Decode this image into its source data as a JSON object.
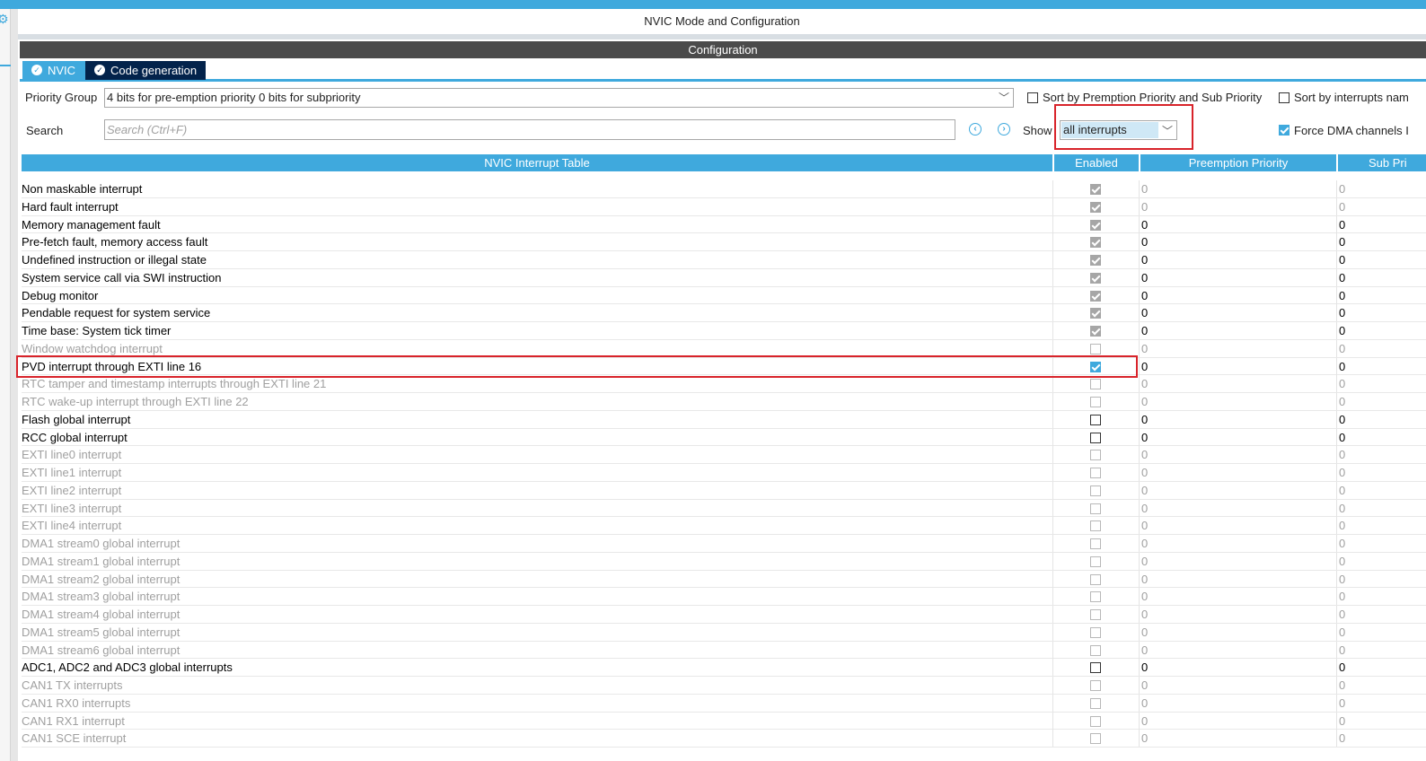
{
  "panel": {
    "title": "NVIC Mode and Configuration",
    "config_bar": "Configuration"
  },
  "tabs": [
    {
      "label": "NVIC"
    },
    {
      "label": "Code generation"
    }
  ],
  "controls": {
    "priority_group_label": "Priority Group",
    "priority_group_value": "4 bits for pre-emption priority 0 bits for subpriority",
    "sort_premption_label": "Sort by Premption Priority and Sub Priority",
    "sort_names_label": "Sort by interrupts nam",
    "search_label": "Search",
    "search_placeholder": "Search (Ctrl+F)",
    "show_label": "Show",
    "show_value": "all interrupts",
    "force_dma_label": "Force DMA channels I"
  },
  "table": {
    "headers": [
      "NVIC Interrupt Table",
      "Enabled",
      "Preemption Priority",
      "Sub Pri"
    ],
    "rows": [
      {
        "name": "Non maskable interrupt",
        "enabled": "on-disabled",
        "pp": "0",
        "sp": "0",
        "style": "grey-val"
      },
      {
        "name": "Hard fault interrupt",
        "enabled": "on-disabled",
        "pp": "0",
        "sp": "0",
        "style": "grey-val"
      },
      {
        "name": "Memory management fault",
        "enabled": "on-disabled",
        "pp": "0",
        "sp": "0",
        "style": ""
      },
      {
        "name": "Pre-fetch fault, memory access fault",
        "enabled": "on-disabled",
        "pp": "0",
        "sp": "0",
        "style": ""
      },
      {
        "name": "Undefined instruction or illegal state",
        "enabled": "on-disabled",
        "pp": "0",
        "sp": "0",
        "style": ""
      },
      {
        "name": "System service call via SWI instruction",
        "enabled": "on-disabled",
        "pp": "0",
        "sp": "0",
        "style": ""
      },
      {
        "name": "Debug monitor",
        "enabled": "on-disabled",
        "pp": "0",
        "sp": "0",
        "style": ""
      },
      {
        "name": "Pendable request for system service",
        "enabled": "on-disabled",
        "pp": "0",
        "sp": "0",
        "style": ""
      },
      {
        "name": "Time base: System tick timer",
        "enabled": "on-disabled",
        "pp": "0",
        "sp": "0",
        "style": ""
      },
      {
        "name": "Window watchdog interrupt",
        "enabled": "off-disabled",
        "pp": "0",
        "sp": "0",
        "style": "dis"
      },
      {
        "name": "PVD interrupt through EXTI line 16",
        "enabled": "on",
        "pp": "0",
        "sp": "0",
        "style": ""
      },
      {
        "name": "RTC tamper and timestamp interrupts through EXTI line 21",
        "enabled": "off-disabled",
        "pp": "0",
        "sp": "0",
        "style": "dis"
      },
      {
        "name": "RTC wake-up interrupt through EXTI line 22",
        "enabled": "off-disabled",
        "pp": "0",
        "sp": "0",
        "style": "dis"
      },
      {
        "name": "Flash global interrupt",
        "enabled": "off",
        "pp": "0",
        "sp": "0",
        "style": ""
      },
      {
        "name": "RCC global interrupt",
        "enabled": "off",
        "pp": "0",
        "sp": "0",
        "style": ""
      },
      {
        "name": "EXTI line0 interrupt",
        "enabled": "off-disabled",
        "pp": "0",
        "sp": "0",
        "style": "dis"
      },
      {
        "name": "EXTI line1 interrupt",
        "enabled": "off-disabled",
        "pp": "0",
        "sp": "0",
        "style": "dis"
      },
      {
        "name": "EXTI line2 interrupt",
        "enabled": "off-disabled",
        "pp": "0",
        "sp": "0",
        "style": "dis"
      },
      {
        "name": "EXTI line3 interrupt",
        "enabled": "off-disabled",
        "pp": "0",
        "sp": "0",
        "style": "dis"
      },
      {
        "name": "EXTI line4 interrupt",
        "enabled": "off-disabled",
        "pp": "0",
        "sp": "0",
        "style": "dis"
      },
      {
        "name": "DMA1 stream0 global interrupt",
        "enabled": "off-disabled",
        "pp": "0",
        "sp": "0",
        "style": "dis"
      },
      {
        "name": "DMA1 stream1 global interrupt",
        "enabled": "off-disabled",
        "pp": "0",
        "sp": "0",
        "style": "dis"
      },
      {
        "name": "DMA1 stream2 global interrupt",
        "enabled": "off-disabled",
        "pp": "0",
        "sp": "0",
        "style": "dis"
      },
      {
        "name": "DMA1 stream3 global interrupt",
        "enabled": "off-disabled",
        "pp": "0",
        "sp": "0",
        "style": "dis"
      },
      {
        "name": "DMA1 stream4 global interrupt",
        "enabled": "off-disabled",
        "pp": "0",
        "sp": "0",
        "style": "dis"
      },
      {
        "name": "DMA1 stream5 global interrupt",
        "enabled": "off-disabled",
        "pp": "0",
        "sp": "0",
        "style": "dis"
      },
      {
        "name": "DMA1 stream6 global interrupt",
        "enabled": "off-disabled",
        "pp": "0",
        "sp": "0",
        "style": "dis"
      },
      {
        "name": "ADC1, ADC2 and ADC3 global interrupts",
        "enabled": "off",
        "pp": "0",
        "sp": "0",
        "style": ""
      },
      {
        "name": "CAN1 TX interrupts",
        "enabled": "off-disabled",
        "pp": "0",
        "sp": "0",
        "style": "dis"
      },
      {
        "name": "CAN1 RX0 interrupts",
        "enabled": "off-disabled",
        "pp": "0",
        "sp": "0",
        "style": "dis"
      },
      {
        "name": "CAN1 RX1 interrupt",
        "enabled": "off-disabled",
        "pp": "0",
        "sp": "0",
        "style": "dis"
      },
      {
        "name": "CAN1 SCE interrupt",
        "enabled": "off-disabled",
        "pp": "0",
        "sp": "0",
        "style": "dis"
      }
    ]
  },
  "colors": {
    "accent": "#3fa9dd",
    "dark_tab": "#03234b",
    "config_bar": "#4b4b4b",
    "highlight": "#d8232a"
  },
  "icons": {
    "gear": "gear-icon",
    "tab_check": "check-circle-icon",
    "prev": "chevron-left-circle-icon",
    "next": "chevron-right-circle-icon",
    "dropdown": "chevron-down-icon"
  }
}
